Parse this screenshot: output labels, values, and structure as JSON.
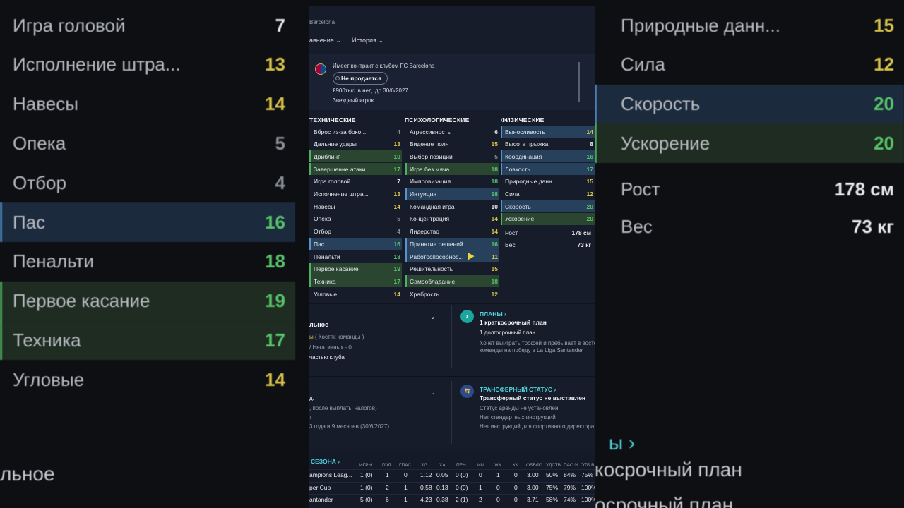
{
  "left_blur": [
    {
      "label": "Игра головой",
      "value": "7",
      "color": "c-white",
      "hl": ""
    },
    {
      "label": "Исполнение штра...",
      "value": "13",
      "color": "c-yellow",
      "hl": ""
    },
    {
      "label": "Навесы",
      "value": "14",
      "color": "c-yellow",
      "hl": ""
    },
    {
      "label": "Опека",
      "value": "5",
      "color": "c-gray",
      "hl": ""
    },
    {
      "label": "Отбор",
      "value": "4",
      "color": "c-gray",
      "hl": ""
    },
    {
      "label": "Пас",
      "value": "16",
      "color": "c-green",
      "hl": "blue"
    },
    {
      "label": "Пенальти",
      "value": "18",
      "color": "c-green",
      "hl": ""
    },
    {
      "label": "Первое касание",
      "value": "19",
      "color": "c-green",
      "hl": "green"
    },
    {
      "label": "Техника",
      "value": "17",
      "color": "c-green",
      "hl": "green"
    },
    {
      "label": "Угловые",
      "value": "14",
      "color": "c-yellow",
      "hl": ""
    }
  ],
  "left_bottom_text": "льное",
  "right_blur": [
    {
      "label": "Природные данн...",
      "value": "15",
      "color": "c-yellow",
      "hl": ""
    },
    {
      "label": "Сила",
      "value": "12",
      "color": "c-yellow",
      "hl": ""
    },
    {
      "label": "Скорость",
      "value": "20",
      "color": "c-green",
      "hl": "blue"
    },
    {
      "label": "Ускорение",
      "value": "20",
      "color": "c-green",
      "hl": "green"
    },
    {
      "label": "Рост",
      "value": "178 см",
      "color": "c-white",
      "hl": ""
    },
    {
      "label": "Вес",
      "value": "73 кг",
      "color": "c-white",
      "hl": ""
    }
  ],
  "right_bottom": {
    "t1": "ы",
    "t2": "косрочный план",
    "t3": "осрочный план"
  },
  "header": {
    "breadcrumb": "Barcelona",
    "nav_left": "авнение",
    "nav_history": "История"
  },
  "contract": {
    "line1": "Имеет контракт с клубом FC Barcelona",
    "status_pill": "Не продается",
    "wage": "£900тыс. в нед. до 30/6/2027",
    "role": "Звездный игрок"
  },
  "technical": {
    "title": "ТЕХНИЧЕСКИЕ",
    "items": [
      {
        "label": "Вброс из-за боко...",
        "value": "4",
        "color": "c-gray",
        "hl": ""
      },
      {
        "label": "Дальние удары",
        "value": "13",
        "color": "c-yellow",
        "hl": ""
      },
      {
        "label": "Дриблинг",
        "value": "19",
        "color": "c-green",
        "hl": "green"
      },
      {
        "label": "Завершение атаки",
        "value": "17",
        "color": "c-green",
        "hl": "green"
      },
      {
        "label": "Игра головой",
        "value": "7",
        "color": "c-white",
        "hl": ""
      },
      {
        "label": "Исполнение штра...",
        "value": "13",
        "color": "c-yellow",
        "hl": ""
      },
      {
        "label": "Навесы",
        "value": "14",
        "color": "c-yellow",
        "hl": ""
      },
      {
        "label": "Опека",
        "value": "5",
        "color": "c-gray",
        "hl": ""
      },
      {
        "label": "Отбор",
        "value": "4",
        "color": "c-gray",
        "hl": ""
      },
      {
        "label": "Пас",
        "value": "16",
        "color": "c-green",
        "hl": "blue"
      },
      {
        "label": "Пенальти",
        "value": "18",
        "color": "c-green",
        "hl": ""
      },
      {
        "label": "Первое касание",
        "value": "19",
        "color": "c-green",
        "hl": "green"
      },
      {
        "label": "Техника",
        "value": "17",
        "color": "c-green",
        "hl": "green"
      },
      {
        "label": "Угловые",
        "value": "14",
        "color": "c-yellow",
        "hl": ""
      }
    ]
  },
  "mental": {
    "title": "ПСИХОЛОГИЧЕСКИЕ",
    "items": [
      {
        "label": "Агрессивность",
        "value": "6",
        "color": "c-white",
        "hl": ""
      },
      {
        "label": "Видение поля",
        "value": "15",
        "color": "c-yellow",
        "hl": ""
      },
      {
        "label": "Выбор позиции",
        "value": "5",
        "color": "c-gray",
        "hl": ""
      },
      {
        "label": "Игра без мяча",
        "value": "18",
        "color": "c-green",
        "hl": "green"
      },
      {
        "label": "Импровизация",
        "value": "18",
        "color": "c-green",
        "hl": ""
      },
      {
        "label": "Интуиция",
        "value": "18",
        "color": "c-green",
        "hl": "blue"
      },
      {
        "label": "Командная игра",
        "value": "10",
        "color": "c-white",
        "hl": ""
      },
      {
        "label": "Концентрация",
        "value": "14",
        "color": "c-yellow",
        "hl": ""
      },
      {
        "label": "Лидерство",
        "value": "14",
        "color": "c-yellow",
        "hl": ""
      },
      {
        "label": "Принятие решений",
        "value": "16",
        "color": "c-green",
        "hl": "blue"
      },
      {
        "label": "Работоспособнос...",
        "value": "11",
        "color": "c-yellow",
        "hl": "blue"
      },
      {
        "label": "Решительность",
        "value": "15",
        "color": "c-yellow",
        "hl": ""
      },
      {
        "label": "Самообладание",
        "value": "18",
        "color": "c-green",
        "hl": "green"
      },
      {
        "label": "Храбрость",
        "value": "12",
        "color": "c-yellow",
        "hl": ""
      }
    ]
  },
  "physical": {
    "title": "ФИЗИЧЕСКИЕ",
    "items": [
      {
        "label": "Выносливость",
        "value": "14",
        "color": "c-yellow",
        "hl": "blue"
      },
      {
        "label": "Высота прыжка",
        "value": "8",
        "color": "c-white",
        "hl": ""
      },
      {
        "label": "Координация",
        "value": "16",
        "color": "c-green",
        "hl": "blue"
      },
      {
        "label": "Ловкость",
        "value": "17",
        "color": "c-green",
        "hl": "blue"
      },
      {
        "label": "Природные данн...",
        "value": "15",
        "color": "c-yellow",
        "hl": ""
      },
      {
        "label": "Сила",
        "value": "12",
        "color": "c-yellow",
        "hl": ""
      },
      {
        "label": "Скорость",
        "value": "20",
        "color": "c-green",
        "hl": "blue"
      },
      {
        "label": "Ускорение",
        "value": "20",
        "color": "c-green",
        "hl": "green"
      }
    ],
    "height_label": "Рост",
    "height_value": "178 см",
    "weight_label": "Вес",
    "weight_value": "73 кг"
  },
  "status_box": {
    "title": "льное",
    "line1a": "ы",
    "line1b": "( Костяк команды )",
    "line2": "/  Негативных - 0",
    "line3": "частью клуба"
  },
  "plans": {
    "title": "ПЛАНЫ",
    "short": "1 краткосрочный план",
    "long": "1 долгосрочный план",
    "desc1": "Хочет выиграть трофей и пребывает в восторге",
    "desc2": "команды на победу в La Liga Santander"
  },
  "wage_box": {
    "line1": "д.",
    "line2": ", после выплаты налогов)",
    "line3": "т",
    "line4": "3 года и 9 месяцев (30/6/2027)"
  },
  "transfer": {
    "title": "ТРАНСФЕРНЫЙ СТАТУС",
    "status": "Трансферный статус не выставлен",
    "loan": "Статус аренды не установлен",
    "instr": "Нет стандартных инструкций",
    "director": "Нет инструкций для спортивного директора"
  },
  "season": {
    "title": "СЕЗОНА",
    "headers": [
      "ИГРЫ",
      "ГОЛ",
      "ГПАС",
      "XG",
      "ХА",
      "ПЕН",
      "ИМ",
      "ЖК",
      "КК",
      "ОБВ/90",
      "УДСТВ",
      "ПАС %",
      "ОТБ В"
    ],
    "rows": [
      {
        "comp": "ampions Leag...",
        "cells": [
          "1 (0)",
          "1",
          "0",
          "1.12",
          "0.05",
          "0 (0)",
          "0",
          "1",
          "0",
          "3.00",
          "50%",
          "84%",
          "75%"
        ]
      },
      {
        "comp": "per Cup",
        "cells": [
          "1 (0)",
          "2",
          "1",
          "0.58",
          "0.13",
          "0 (0)",
          "1",
          "0",
          "0",
          "3.00",
          "75%",
          "79%",
          "100%"
        ]
      },
      {
        "comp": "antander",
        "cells": [
          "5 (0)",
          "6",
          "1",
          "4.23",
          "0.38",
          "2 (1)",
          "2",
          "0",
          "0",
          "3.71",
          "58%",
          "74%",
          "100%"
        ]
      }
    ]
  },
  "icons": {
    "chevron": "chevron-down-icon",
    "arrow": "chevron-right-icon",
    "crest": "club-crest-icon",
    "transfer": "transfer-icon",
    "cursor": "mouse-cursor-icon"
  }
}
